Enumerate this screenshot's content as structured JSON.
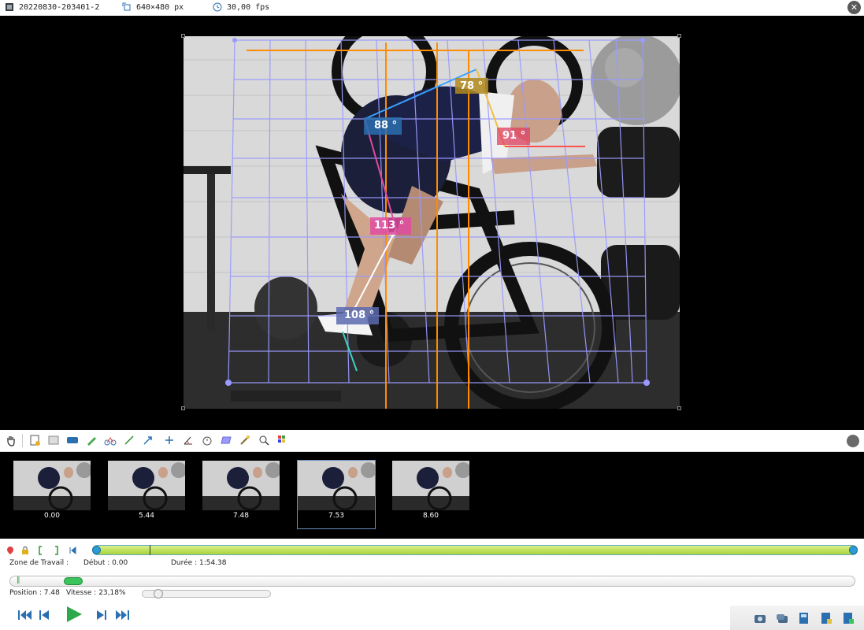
{
  "header": {
    "filename": "20220830-203401-2",
    "resolution": "640×480 px",
    "framerate": "30,00 fps"
  },
  "annotations": {
    "angles": [
      "78 °",
      "88 °",
      "91 °",
      "113 °",
      "108 °"
    ]
  },
  "thumbnails": [
    {
      "label": "0.00",
      "selected": false
    },
    {
      "label": "5.44",
      "selected": false
    },
    {
      "label": "7.48",
      "selected": false
    },
    {
      "label": "7.53",
      "selected": true
    },
    {
      "label": "8.60",
      "selected": false
    }
  ],
  "working_zone": {
    "label": "Zone de Travail :",
    "start": "Début : 0.00",
    "duration": "Durée : 1:54.38"
  },
  "playback": {
    "position": "Position : 7.48",
    "speed": "Vitesse : 23,18%",
    "position_fraction": 0.065,
    "speed_fraction": 0.09
  },
  "colors": {
    "accent_green": "#3bc45b",
    "zone_green": "#a7d43b",
    "play_blue": "#2a7fc4",
    "grid": "#9a9aff",
    "orange": "#ff8c00"
  }
}
